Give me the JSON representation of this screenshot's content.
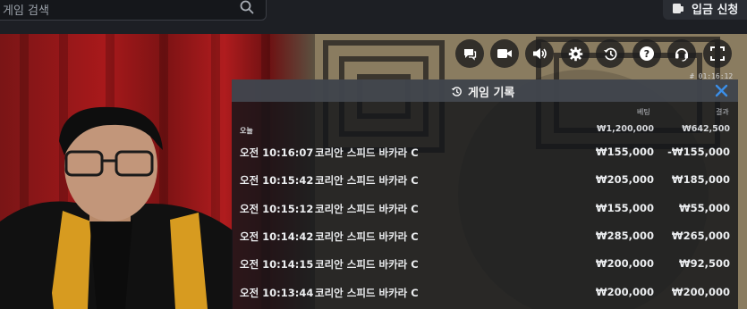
{
  "topbar": {
    "search_placeholder": "게임 검색",
    "deposit_label": "입금 신청"
  },
  "video": {
    "timer": "# 01:16:12"
  },
  "controls": [
    {
      "name": "chat-icon"
    },
    {
      "name": "video-camera-icon"
    },
    {
      "name": "volume-icon"
    },
    {
      "name": "settings-gear-icon"
    },
    {
      "name": "history-icon"
    },
    {
      "name": "help-icon"
    },
    {
      "name": "headset-support-icon"
    },
    {
      "name": "fullscreen-icon"
    }
  ],
  "history": {
    "title": "게임 기록",
    "col_bet": "베팅",
    "col_result": "결과",
    "summary": {
      "label": "오늘",
      "bet": "₩1,200,000",
      "result": "₩642,500"
    },
    "rows": [
      {
        "time": "오전 10:16:07",
        "game": "코리안 스피드 바카라 C",
        "bet": "₩155,000",
        "result": "-₩155,000"
      },
      {
        "time": "오전 10:15:42",
        "game": "코리안 스피드 바카라 C",
        "bet": "₩205,000",
        "result": "₩185,000"
      },
      {
        "time": "오전 10:15:12",
        "game": "코리안 스피드 바카라 C",
        "bet": "₩155,000",
        "result": "₩55,000"
      },
      {
        "time": "오전 10:14:42",
        "game": "코리안 스피드 바카라 C",
        "bet": "₩285,000",
        "result": "₩265,000"
      },
      {
        "time": "오전 10:14:15",
        "game": "코리안 스피드 바카라 C",
        "bet": "₩200,000",
        "result": "₩92,500"
      },
      {
        "time": "오전 10:13:44",
        "game": "코리안 스피드 바카라 C",
        "bet": "₩200,000",
        "result": "₩200,000"
      }
    ]
  },
  "colors": {
    "accent_close": "#3b8fe8",
    "panel_bg": "#14161a",
    "curtain": "#a8191b"
  }
}
